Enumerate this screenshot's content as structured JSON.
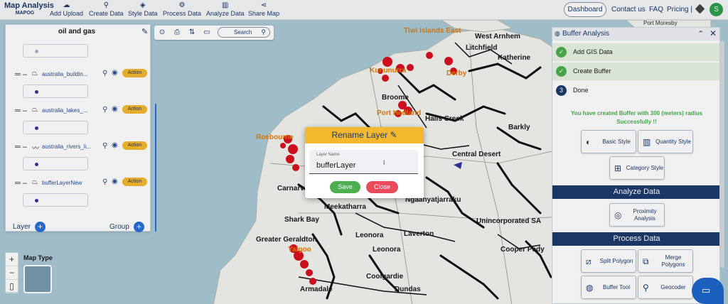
{
  "app": {
    "title": "Map Analysis",
    "subtitle": "MAPOG"
  },
  "nav": [
    {
      "label": "Add Upload",
      "icon": "cloud-upload-icon"
    },
    {
      "label": "Create Data",
      "icon": "location-pin-icon"
    },
    {
      "label": "Style Data",
      "icon": "paint-bucket-icon"
    },
    {
      "label": "Process Data",
      "icon": "process-icon"
    },
    {
      "label": "Analyze Data",
      "icon": "bar-chart-icon"
    },
    {
      "label": "Share Map",
      "icon": "share-icon"
    }
  ],
  "top_right": {
    "dashboard": "Dashboard",
    "contact": "Contact us",
    "faq": "FAQ",
    "pricing": "Pricing |",
    "avatar": "S"
  },
  "map_tools": {
    "search": "Search"
  },
  "layer_panel": {
    "title": "oil and gas",
    "layers": [
      {
        "name": "australia_buildin...",
        "action": "Action",
        "geom": "polygon"
      },
      {
        "name": "australia_lakes_...",
        "action": "Action",
        "geom": "polygon"
      },
      {
        "name": "australia_rivers_li...",
        "action": "Action",
        "geom": "line"
      },
      {
        "name": "bufferLayerNew",
        "action": "Action",
        "geom": "polygon"
      }
    ],
    "footer_layer": "Layer",
    "footer_group": "Group"
  },
  "map_type": {
    "label": "Map Type"
  },
  "map_labels": {
    "dark": [
      "West Arnhem",
      "Litchfield",
      "Katherine",
      "Broome",
      "Halls Creek",
      "Central Desert",
      "Barkly",
      "Carnarvon",
      "Meekatharra",
      "Ngaanyatjarraku",
      "Shark Bay",
      "Greater Geraldton",
      "Laverton",
      "Leonora",
      "Coolgardie",
      "Dundas",
      "Cooper Pedy",
      "Unincorporated SA",
      "Armadale",
      "Port Moresby"
    ],
    "orange": [
      "Tiwi Islands East",
      "Kununurra",
      "Derby",
      "Port Hedland",
      "Roebourne",
      "Yalgoo"
    ]
  },
  "rename_dialog": {
    "title": "Rename Layer",
    "field_label": "Layer Name",
    "field_value": "bufferLayer",
    "save": "Save",
    "close": "Close"
  },
  "buffer_panel": {
    "title": "Buffer Analysis",
    "steps": [
      {
        "label": "Add GIS Data",
        "status": "done"
      },
      {
        "label": "Create Buffer",
        "status": "done"
      },
      {
        "label": "Done",
        "status": "current",
        "number": "3"
      }
    ],
    "message_line1": "You have created Buffer with 300 (meters) radius",
    "message_line2": "Successfully !!",
    "style_buttons": [
      {
        "label": "Basic Style",
        "icon": "palette-icon"
      },
      {
        "label": "Quantity Style",
        "icon": "quantity-icon"
      },
      {
        "label": "Category Style",
        "icon": "category-grid-icon"
      }
    ],
    "analyze_heading": "Analyze Data",
    "analyze_buttons": [
      {
        "label": "Proximity Analysis",
        "icon": "proximity-icon"
      }
    ],
    "process_heading": "Process Data",
    "process_buttons": [
      {
        "label": "Split Polygon",
        "icon": "split-polygon-icon"
      },
      {
        "label": "Merge Polygons",
        "icon": "merge-polygons-icon"
      },
      {
        "label": "Buffer Tool",
        "icon": "buffer-icon"
      },
      {
        "label": "Geocoder",
        "icon": "geocoder-icon"
      }
    ]
  },
  "colors": {
    "accent": "#1b3a6b",
    "warning": "#f3b82e",
    "success": "#4caf50",
    "danger": "#e94a5c",
    "buffer_red": "#d8101e"
  }
}
